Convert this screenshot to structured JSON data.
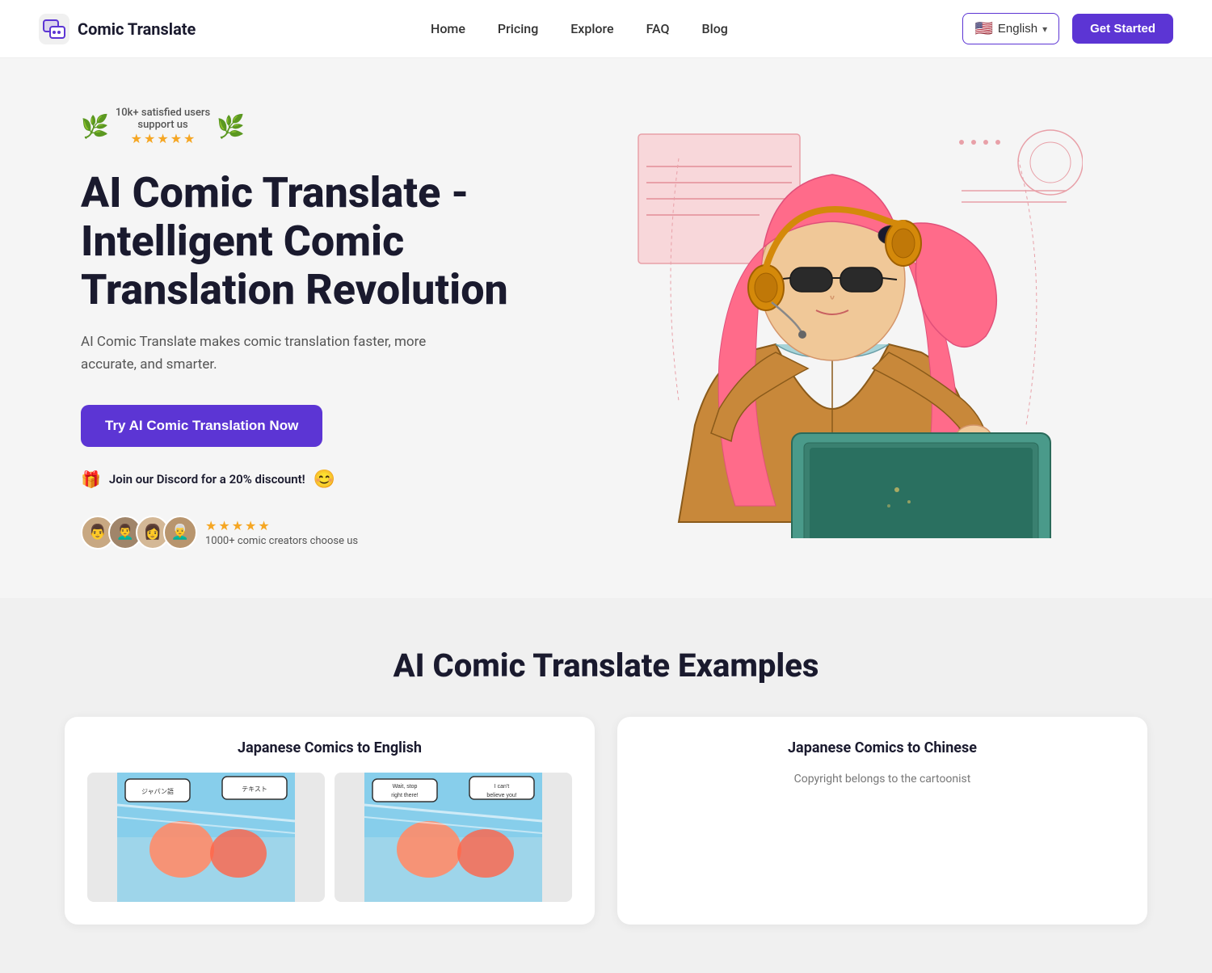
{
  "header": {
    "logo_text": "Comic Translate",
    "nav": {
      "home": "Home",
      "pricing": "Pricing",
      "explore": "Explore",
      "faq": "FAQ",
      "blog": "Blog"
    },
    "lang_label": "English",
    "get_started": "Get Started"
  },
  "hero": {
    "award_count": "10k+ satisfied users",
    "award_support": "support us",
    "title": "AI Comic Translate - Intelligent Comic Translation Revolution",
    "subtitle": "AI Comic Translate makes comic translation faster, more accurate, and smarter.",
    "cta_button": "Try AI Comic Translation Now",
    "discord_text": "Join our Discord for a 20% discount!",
    "user_count": "1000+ comic creators choose us"
  },
  "examples": {
    "section_title": "AI Comic Translate Examples",
    "card1_title": "Japanese Comics to English",
    "card2_title": "Japanese Comics to Chinese",
    "card2_copyright": "Copyright belongs to the cartoonist"
  },
  "avatars": [
    {
      "emoji": "👨"
    },
    {
      "emoji": "👨‍🦱"
    },
    {
      "emoji": "👩"
    },
    {
      "emoji": "👨‍🦳"
    }
  ]
}
